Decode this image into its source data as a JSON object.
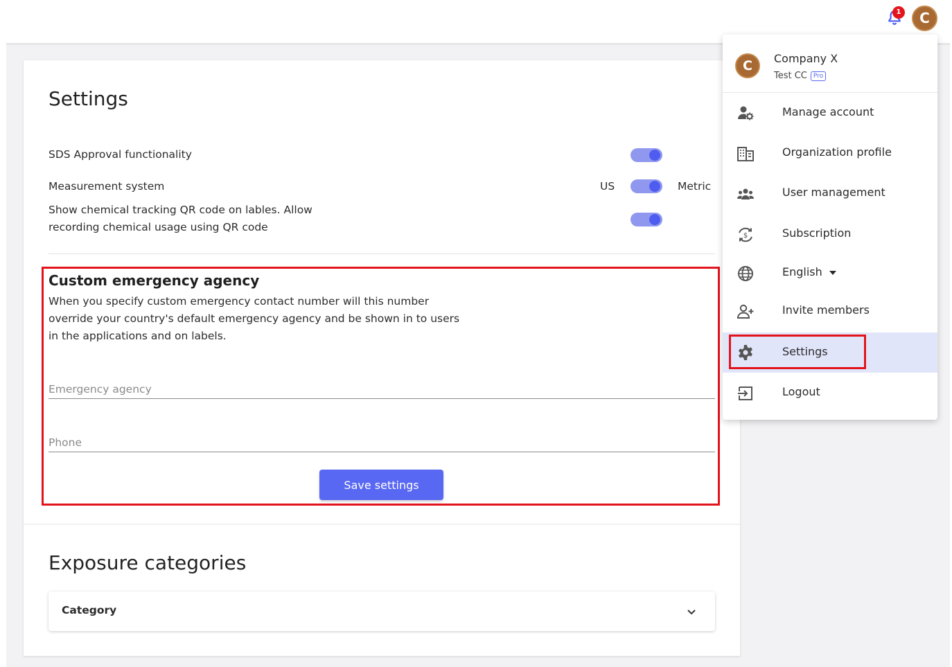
{
  "topbar": {
    "notification_count": "1",
    "avatar_initial": "C"
  },
  "settings": {
    "title": "Settings",
    "sds_label": "SDS Approval functionality",
    "measurement_label": "Measurement system",
    "unit_left": "US",
    "unit_right": "Metric",
    "qr_label": "Show chemical tracking QR code on lables. Allow recording chemical usage using QR code",
    "toggles": {
      "sds_on": true,
      "measurement_metric": true,
      "qr_on": true
    }
  },
  "emergency": {
    "title": "Custom emergency agency",
    "description": "When you specify custom emergency contact number will this number override your country's default emergency agency and be shown in to users in the applications and on labels.",
    "agency_placeholder": "Emergency agency",
    "agency_value": "",
    "phone_placeholder": "Phone",
    "phone_value": "",
    "save_label": "Save settings"
  },
  "exposure": {
    "title": "Exposure categories",
    "select_label": "Category"
  },
  "menu": {
    "avatar_initial": "C",
    "company": "Company X",
    "subtitle": "Test CC",
    "plan_badge": "Pro",
    "items": [
      {
        "label": "Manage account",
        "icon": "manage-account-icon"
      },
      {
        "label": "Organization profile",
        "icon": "building-icon"
      },
      {
        "label": "User management",
        "icon": "users-icon"
      },
      {
        "label": "Subscription",
        "icon": "subscription-icon"
      },
      {
        "label": "English",
        "icon": "globe-icon"
      },
      {
        "label": "Invite members",
        "icon": "add-user-icon"
      },
      {
        "label": "Settings",
        "icon": "gear-icon",
        "active": true
      },
      {
        "label": "Logout",
        "icon": "logout-icon"
      }
    ]
  },
  "colors": {
    "accent": "#5968f2",
    "toggle_track": "#8f98ee",
    "highlight": "#e3131b",
    "avatar": "#a86a32",
    "active_item": "#e1e5fa"
  }
}
